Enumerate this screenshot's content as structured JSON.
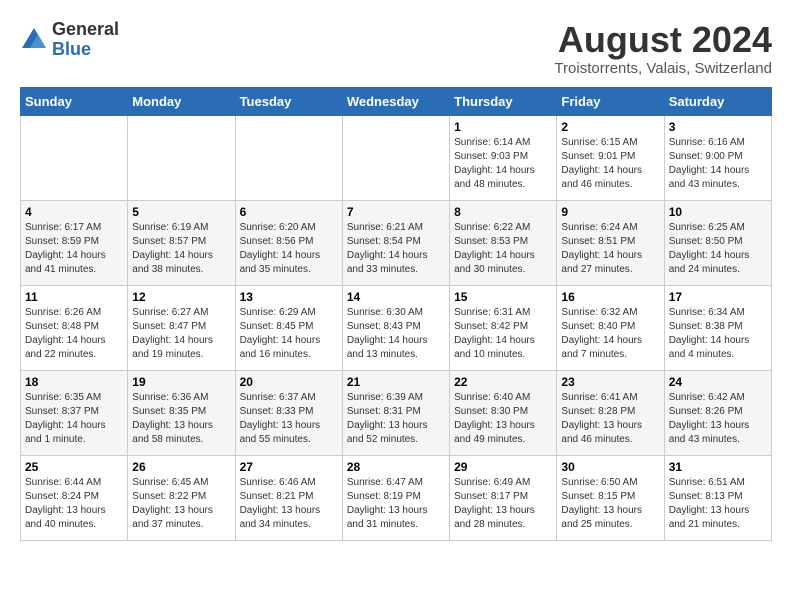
{
  "header": {
    "logo_general": "General",
    "logo_blue": "Blue",
    "month_title": "August 2024",
    "location": "Troistorrents, Valais, Switzerland"
  },
  "weekdays": [
    "Sunday",
    "Monday",
    "Tuesday",
    "Wednesday",
    "Thursday",
    "Friday",
    "Saturday"
  ],
  "weeks": [
    [
      {
        "day": "",
        "content": ""
      },
      {
        "day": "",
        "content": ""
      },
      {
        "day": "",
        "content": ""
      },
      {
        "day": "",
        "content": ""
      },
      {
        "day": "1",
        "content": "Sunrise: 6:14 AM\nSunset: 9:03 PM\nDaylight: 14 hours\nand 48 minutes."
      },
      {
        "day": "2",
        "content": "Sunrise: 6:15 AM\nSunset: 9:01 PM\nDaylight: 14 hours\nand 46 minutes."
      },
      {
        "day": "3",
        "content": "Sunrise: 6:16 AM\nSunset: 9:00 PM\nDaylight: 14 hours\nand 43 minutes."
      }
    ],
    [
      {
        "day": "4",
        "content": "Sunrise: 6:17 AM\nSunset: 8:59 PM\nDaylight: 14 hours\nand 41 minutes."
      },
      {
        "day": "5",
        "content": "Sunrise: 6:19 AM\nSunset: 8:57 PM\nDaylight: 14 hours\nand 38 minutes."
      },
      {
        "day": "6",
        "content": "Sunrise: 6:20 AM\nSunset: 8:56 PM\nDaylight: 14 hours\nand 35 minutes."
      },
      {
        "day": "7",
        "content": "Sunrise: 6:21 AM\nSunset: 8:54 PM\nDaylight: 14 hours\nand 33 minutes."
      },
      {
        "day": "8",
        "content": "Sunrise: 6:22 AM\nSunset: 8:53 PM\nDaylight: 14 hours\nand 30 minutes."
      },
      {
        "day": "9",
        "content": "Sunrise: 6:24 AM\nSunset: 8:51 PM\nDaylight: 14 hours\nand 27 minutes."
      },
      {
        "day": "10",
        "content": "Sunrise: 6:25 AM\nSunset: 8:50 PM\nDaylight: 14 hours\nand 24 minutes."
      }
    ],
    [
      {
        "day": "11",
        "content": "Sunrise: 6:26 AM\nSunset: 8:48 PM\nDaylight: 14 hours\nand 22 minutes."
      },
      {
        "day": "12",
        "content": "Sunrise: 6:27 AM\nSunset: 8:47 PM\nDaylight: 14 hours\nand 19 minutes."
      },
      {
        "day": "13",
        "content": "Sunrise: 6:29 AM\nSunset: 8:45 PM\nDaylight: 14 hours\nand 16 minutes."
      },
      {
        "day": "14",
        "content": "Sunrise: 6:30 AM\nSunset: 8:43 PM\nDaylight: 14 hours\nand 13 minutes."
      },
      {
        "day": "15",
        "content": "Sunrise: 6:31 AM\nSunset: 8:42 PM\nDaylight: 14 hours\nand 10 minutes."
      },
      {
        "day": "16",
        "content": "Sunrise: 6:32 AM\nSunset: 8:40 PM\nDaylight: 14 hours\nand 7 minutes."
      },
      {
        "day": "17",
        "content": "Sunrise: 6:34 AM\nSunset: 8:38 PM\nDaylight: 14 hours\nand 4 minutes."
      }
    ],
    [
      {
        "day": "18",
        "content": "Sunrise: 6:35 AM\nSunset: 8:37 PM\nDaylight: 14 hours\nand 1 minute."
      },
      {
        "day": "19",
        "content": "Sunrise: 6:36 AM\nSunset: 8:35 PM\nDaylight: 13 hours\nand 58 minutes."
      },
      {
        "day": "20",
        "content": "Sunrise: 6:37 AM\nSunset: 8:33 PM\nDaylight: 13 hours\nand 55 minutes."
      },
      {
        "day": "21",
        "content": "Sunrise: 6:39 AM\nSunset: 8:31 PM\nDaylight: 13 hours\nand 52 minutes."
      },
      {
        "day": "22",
        "content": "Sunrise: 6:40 AM\nSunset: 8:30 PM\nDaylight: 13 hours\nand 49 minutes."
      },
      {
        "day": "23",
        "content": "Sunrise: 6:41 AM\nSunset: 8:28 PM\nDaylight: 13 hours\nand 46 minutes."
      },
      {
        "day": "24",
        "content": "Sunrise: 6:42 AM\nSunset: 8:26 PM\nDaylight: 13 hours\nand 43 minutes."
      }
    ],
    [
      {
        "day": "25",
        "content": "Sunrise: 6:44 AM\nSunset: 8:24 PM\nDaylight: 13 hours\nand 40 minutes."
      },
      {
        "day": "26",
        "content": "Sunrise: 6:45 AM\nSunset: 8:22 PM\nDaylight: 13 hours\nand 37 minutes."
      },
      {
        "day": "27",
        "content": "Sunrise: 6:46 AM\nSunset: 8:21 PM\nDaylight: 13 hours\nand 34 minutes."
      },
      {
        "day": "28",
        "content": "Sunrise: 6:47 AM\nSunset: 8:19 PM\nDaylight: 13 hours\nand 31 minutes."
      },
      {
        "day": "29",
        "content": "Sunrise: 6:49 AM\nSunset: 8:17 PM\nDaylight: 13 hours\nand 28 minutes."
      },
      {
        "day": "30",
        "content": "Sunrise: 6:50 AM\nSunset: 8:15 PM\nDaylight: 13 hours\nand 25 minutes."
      },
      {
        "day": "31",
        "content": "Sunrise: 6:51 AM\nSunset: 8:13 PM\nDaylight: 13 hours\nand 21 minutes."
      }
    ]
  ]
}
